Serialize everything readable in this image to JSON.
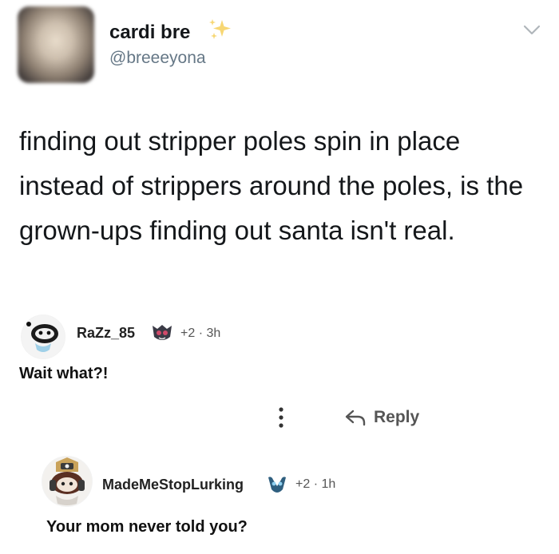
{
  "tweet": {
    "display_name": "cardi bre",
    "handle": "@breeeyona",
    "text": "finding out stripper poles spin in place instead of strippers around the poles, is the grown-ups finding out santa isn't real."
  },
  "comments": [
    {
      "username": "RaZz_85",
      "meta": "+2 · 3h",
      "text": "Wait what?!"
    },
    {
      "username": "MadeMeStopLurking",
      "meta": "+2 · 1h",
      "text": "Your mom never told you?"
    }
  ],
  "actions": {
    "reply_label": "Reply"
  },
  "colors": {
    "text": "#14171a",
    "secondary": "#657786",
    "sparkle": "#f5d36b"
  }
}
